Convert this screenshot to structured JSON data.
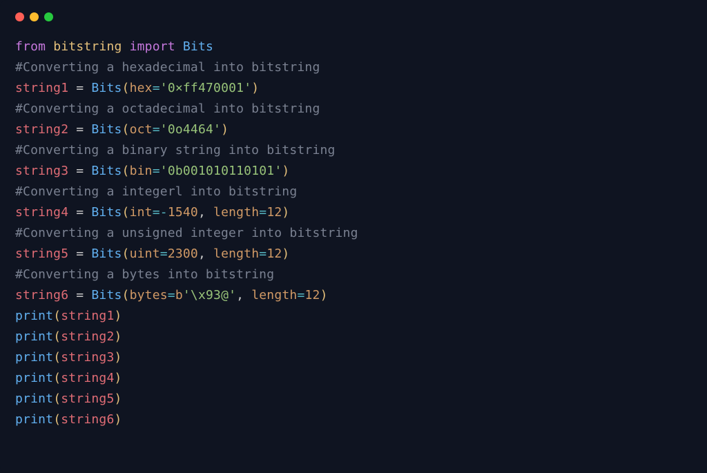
{
  "colors": {
    "background": "#0f1421",
    "traffic": {
      "red": "#ff5f56",
      "yellow": "#ffbd2e",
      "green": "#27c93f"
    },
    "keyword": "#c678dd",
    "module": "#e5c07b",
    "class_func": "#61afef",
    "comment": "#7a8191",
    "variable": "#e06c75",
    "kwarg_name": "#d19a66",
    "equals": "#56b6c2",
    "string": "#98c379",
    "number": "#d19a66",
    "paren": "#e5c07b",
    "default": "#c9c9c9"
  },
  "tokens": {
    "kw_from": "from",
    "kw_import": "import",
    "mod_bitstring": "bitstring",
    "cls_Bits": "Bits",
    "fn_print": "print",
    "op_assign": " = ",
    "lparen": "(",
    "rparen": ")",
    "comma_sp": ", ",
    "eq": "=",
    "minus": "-",
    "sq": "'",
    "bprefix": "b"
  },
  "code": {
    "comment1": "#Converting a hexadecimal into bitstring",
    "comment2": "#Converting a octadecimal into bitstring",
    "comment3": "#Converting a binary string into bitstring",
    "comment4": "#Converting a integerl into bitstring",
    "comment5": "#Converting a unsigned integer into bitstring",
    "comment6": "#Converting a bytes into bitstring",
    "var1": "string1",
    "var2": "string2",
    "var3": "string3",
    "var4": "string4",
    "var5": "string5",
    "var6": "string6",
    "kw_hex": "hex",
    "kw_oct": "oct",
    "kw_bin": "bin",
    "kw_int": "int",
    "kw_uint": "uint",
    "kw_bytes": "bytes",
    "kw_length": "length",
    "val_hex": "0×ff470001",
    "val_oct": "0o4464",
    "val_bin": "0b001010110101",
    "val_int": "1540",
    "val_uint": "2300",
    "val_len12": "12",
    "val_bytes": "\\x93@"
  }
}
